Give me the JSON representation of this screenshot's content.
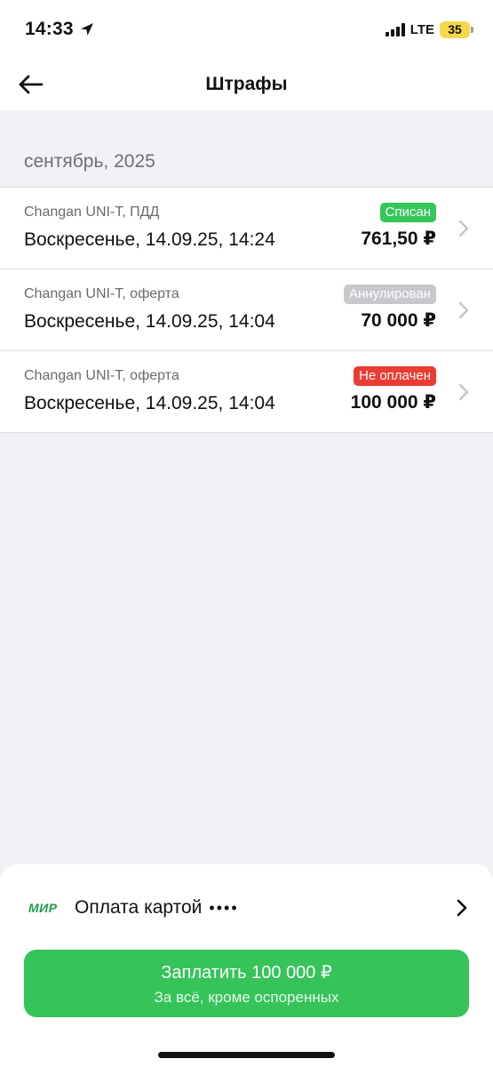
{
  "status_bar": {
    "time": "14:33",
    "network": "LTE",
    "battery": "35"
  },
  "nav": {
    "title": "Штрафы"
  },
  "section": {
    "month": "сентябрь, 2025"
  },
  "fines": [
    {
      "car": "Changan UNI-T, ПДД",
      "date": "Воскресенье, 14.09.25, 14:24",
      "status": "Списан",
      "status_color": "#34c759",
      "amount": "761,50 ₽"
    },
    {
      "car": "Changan UNI-T, оферта",
      "date": "Воскресенье, 14.09.25, 14:04",
      "status": "Аннулирован",
      "status_color": "#c7c8cc",
      "amount": "70 000 ₽"
    },
    {
      "car": "Changan UNI-T, оферта",
      "date": "Воскресенье, 14.09.25, 14:04",
      "status": "Не оплачен",
      "status_color": "#eb3b32",
      "amount": "100 000 ₽"
    }
  ],
  "payment": {
    "logo": "МИР",
    "label": "Оплата картой",
    "dots": "••••"
  },
  "pay_button": {
    "label": "Заплатить 100 000 ₽",
    "sublabel": "За всё, кроме оспоренных",
    "color": "#36c35a"
  }
}
